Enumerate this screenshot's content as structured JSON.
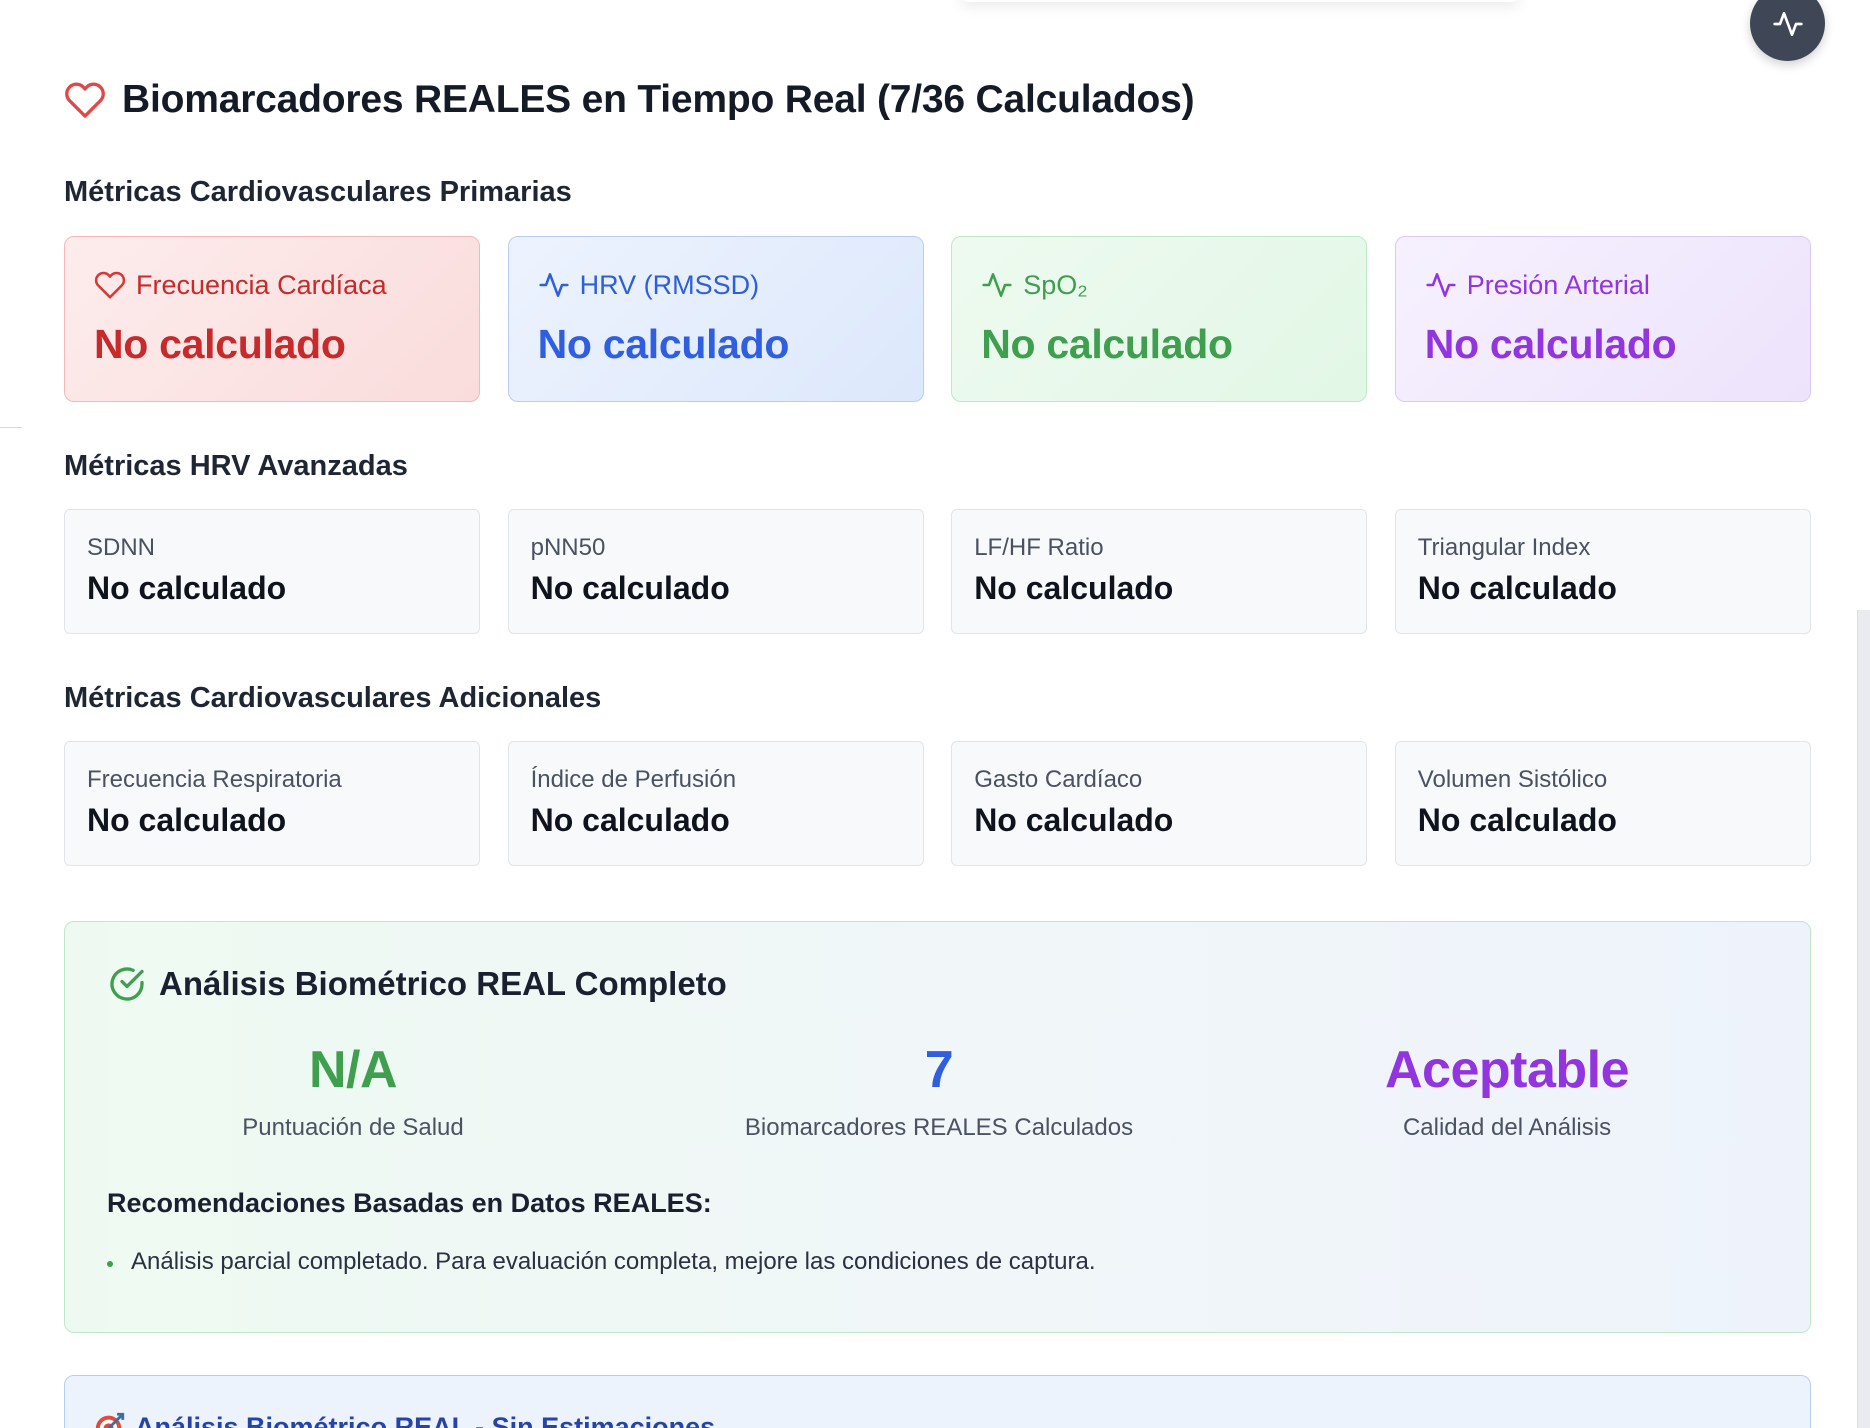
{
  "header": {
    "title": "Biomarcadores REALES en Tiempo Real (7/36 Calculados)"
  },
  "sections": {
    "primary_title": "Métricas Cardiovasculares Primarias",
    "hrv_title": "Métricas HRV Avanzadas",
    "additional_title": "Métricas Cardiovasculares Adicionales"
  },
  "primary": [
    {
      "label": "Frecuencia Cardíaca",
      "value": "No calculado",
      "icon": "heart-icon",
      "color": "#c62a2a"
    },
    {
      "label": "HRV (RMSSD)",
      "value": "No calculado",
      "icon": "pulse-icon",
      "color": "#2f5ee0"
    },
    {
      "label": "SpO₂",
      "value": "No calculado",
      "icon": "pulse-icon",
      "color": "#3f9f4e"
    },
    {
      "label": "Presión Arterial",
      "value": "No calculado",
      "icon": "pulse-icon",
      "color": "#9235df"
    }
  ],
  "hrv": [
    {
      "label": "SDNN",
      "value": "No calculado"
    },
    {
      "label": "pNN50",
      "value": "No calculado"
    },
    {
      "label": "LF/HF Ratio",
      "value": "No calculado"
    },
    {
      "label": "Triangular Index",
      "value": "No calculado"
    }
  ],
  "additional": [
    {
      "label": "Frecuencia Respiratoria",
      "value": "No calculado"
    },
    {
      "label": "Índice de Perfusión",
      "value": "No calculado"
    },
    {
      "label": "Gasto Cardíaco",
      "value": "No calculado"
    },
    {
      "label": "Volumen Sistólico",
      "value": "No calculado"
    }
  ],
  "analysis": {
    "title": "Análisis Biométrico REAL Completo",
    "stats": [
      {
        "value": "N/A",
        "caption": "Puntuación de Salud",
        "color": "#3f9f4e"
      },
      {
        "value": "7",
        "caption": "Biomarcadores REALES Calculados",
        "color": "#2f5ee0"
      },
      {
        "value": "Aceptable",
        "caption": "Calidad del Análisis",
        "color": "#9235df"
      }
    ],
    "recommendations_title": "Recomendaciones Basadas en Datos REALES:",
    "recommendations": [
      "Análisis parcial completado. Para evaluación completa, mejore las condiciones de captura."
    ]
  },
  "bottom": {
    "title": "Análisis Biométrico REAL - Sin Estimaciones",
    "icon": "target-icon"
  },
  "floating": {
    "icon": "pulse-icon"
  }
}
